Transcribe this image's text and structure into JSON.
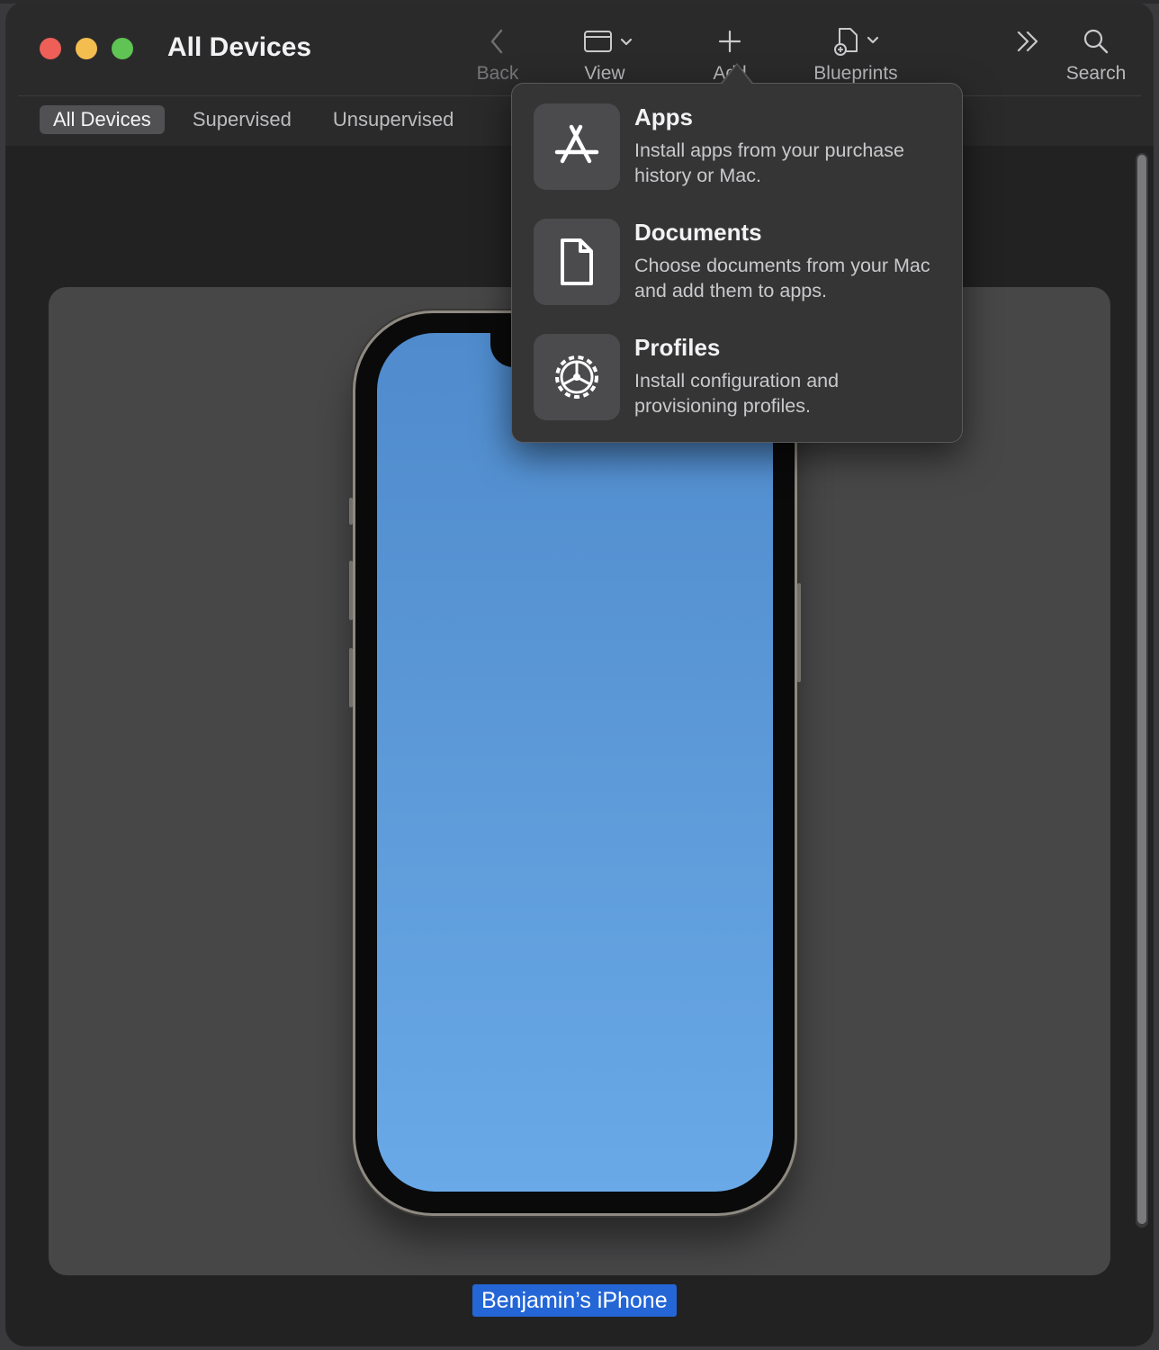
{
  "window": {
    "title": "All Devices"
  },
  "toolbar": {
    "back_label": "Back",
    "view_label": "View",
    "add_label": "Add",
    "blueprints_label": "Blueprints",
    "search_label": "Search",
    "more_icon": "chevron-double-right-icon"
  },
  "segments": [
    {
      "label": "All Devices",
      "active": true
    },
    {
      "label": "Supervised",
      "active": false
    },
    {
      "label": "Unsupervised",
      "active": false
    }
  ],
  "add_menu": {
    "items": [
      {
        "title": "Apps",
        "description": "Install apps from your purchase history or Mac.",
        "icon": "app-store-icon"
      },
      {
        "title": "Documents",
        "description": "Choose documents from your Mac and add them to apps.",
        "icon": "document-icon"
      },
      {
        "title": "Profiles",
        "description": "Install configuration and provisioning profiles.",
        "icon": "gear-icon"
      }
    ]
  },
  "device": {
    "name": "Benjamin’s iPhone"
  },
  "colors": {
    "accent": "#2466d6",
    "close": "#ed5f57",
    "minimize": "#f4bd4f",
    "zoom": "#5fc453"
  }
}
